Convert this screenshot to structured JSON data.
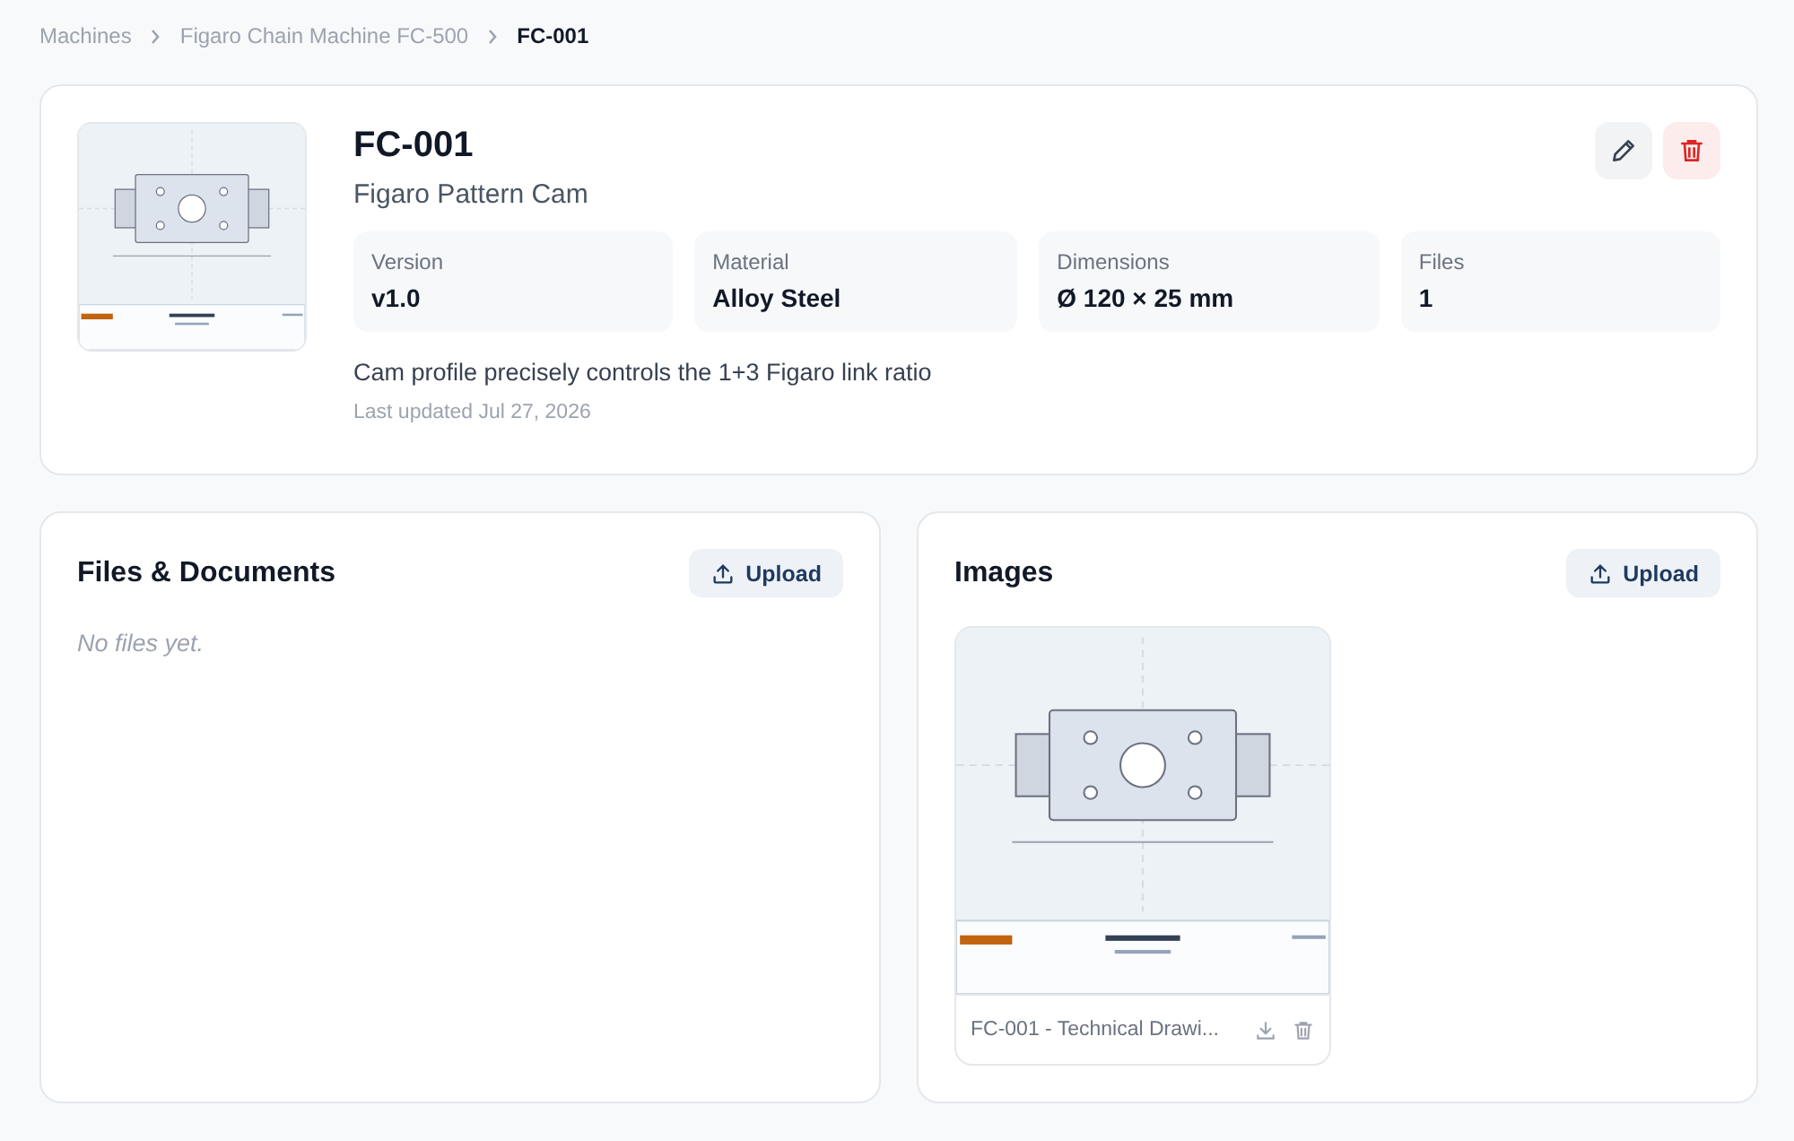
{
  "breadcrumb": [
    {
      "label": "Machines",
      "current": false
    },
    {
      "label": "Figaro Chain Machine FC-500",
      "current": false
    },
    {
      "label": "FC-001",
      "current": true
    }
  ],
  "part": {
    "code": "FC-001",
    "name": "Figaro Pattern Cam",
    "specs": [
      {
        "label": "Version",
        "value": "v1.0"
      },
      {
        "label": "Material",
        "value": "Alloy Steel"
      },
      {
        "label": "Dimensions",
        "value": "Ø 120 × 25 mm"
      },
      {
        "label": "Files",
        "value": "1"
      }
    ],
    "description": "Cam profile precisely controls the 1+3 Figaro link ratio",
    "updated": "Last updated Jul 27, 2026"
  },
  "files": {
    "title": "Files & Documents",
    "upload": "Upload",
    "empty": "No files yet."
  },
  "images": {
    "title": "Images",
    "upload": "Upload",
    "items": [
      {
        "kind": "picture",
        "caption": "FC-001 - Technical Drawi..."
      }
    ]
  }
}
